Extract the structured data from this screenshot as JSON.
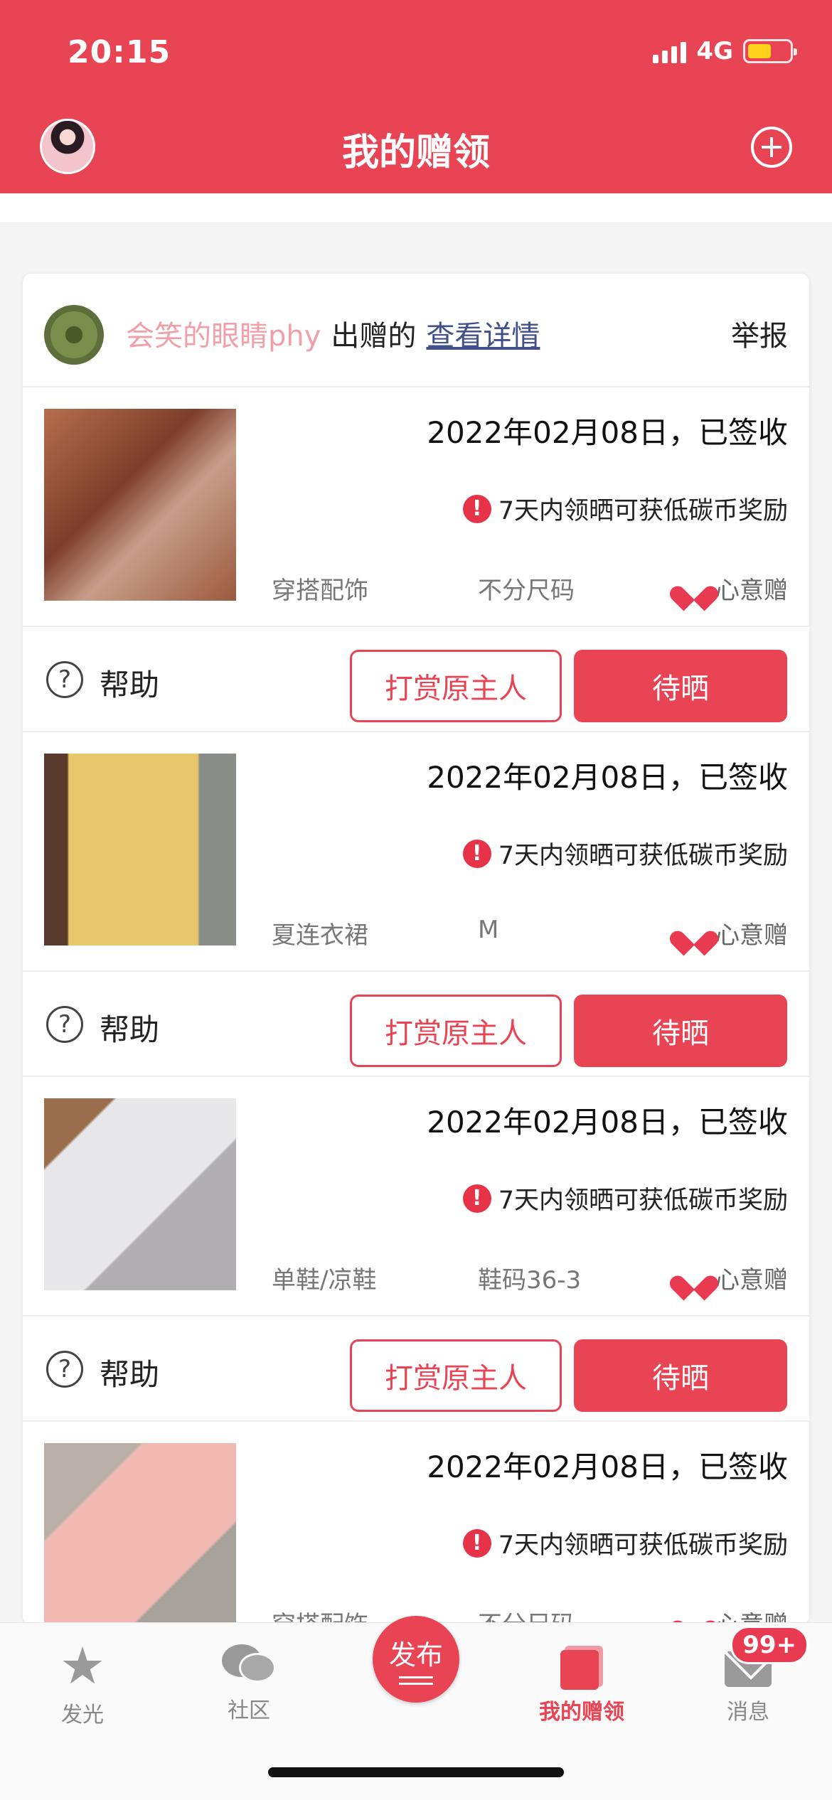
{
  "status_bar": {
    "time": "20:15",
    "network": "4G"
  },
  "header": {
    "title": "我的赠领"
  },
  "card": {
    "giver_name": "会笑的眼睛phy",
    "giver_suffix": "出赠的",
    "detail_link": "查看详情",
    "report_link": "举报"
  },
  "items": [
    {
      "date": "2022年02月08日，已签收",
      "reward": "7天内领晒可获低碳币奖励",
      "category": "穿搭配饰",
      "size": "不分尺码",
      "type": "心意赠"
    },
    {
      "date": "2022年02月08日，已签收",
      "reward": "7天内领晒可获低碳币奖励",
      "category": "夏连衣裙",
      "size": "M",
      "type": "心意赠"
    },
    {
      "date": "2022年02月08日，已签收",
      "reward": "7天内领晒可获低碳币奖励",
      "category": "单鞋/凉鞋",
      "size": "鞋码36-3",
      "type": "心意赠"
    },
    {
      "date": "2022年02月08日，已签收",
      "reward": "7天内领晒可获低碳币奖励",
      "category": "穿搭配饰",
      "size": "不分尺码",
      "type": "心意赠"
    }
  ],
  "actions": {
    "help": "帮助",
    "tip": "打赏原主人",
    "post": "待晒"
  },
  "tabbar": {
    "shine": "发光",
    "community": "社区",
    "publish": "发布",
    "my_gifts": "我的赠领",
    "messages": "消息",
    "message_badge": "99+"
  },
  "colors": {
    "brand": "#e84454",
    "heart": "#e83a50",
    "giver_name": "#f0a0a8",
    "link": "#41508a"
  }
}
